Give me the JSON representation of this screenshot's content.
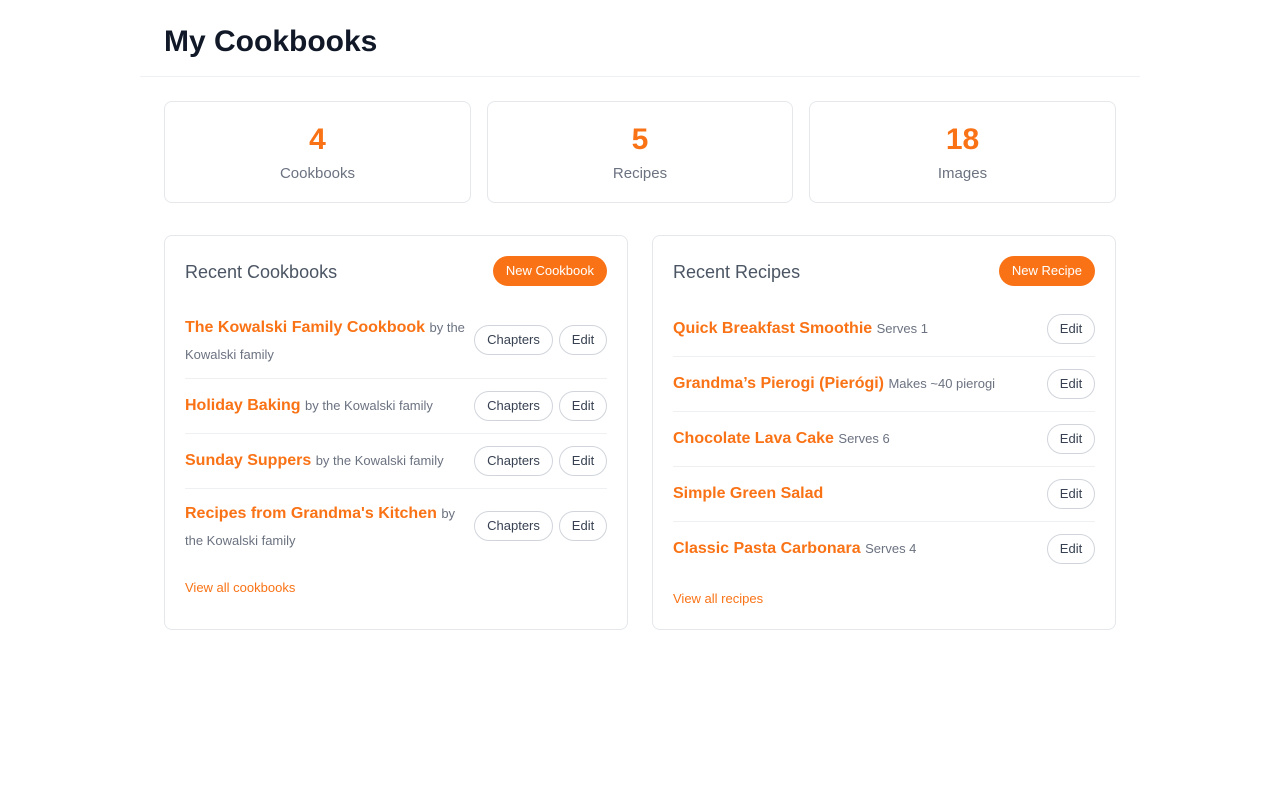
{
  "page": {
    "title": "My Cookbooks"
  },
  "stats": [
    {
      "value": "4",
      "label": "Cookbooks"
    },
    {
      "value": "5",
      "label": "Recipes"
    },
    {
      "value": "18",
      "label": "Images"
    }
  ],
  "recent_cookbooks": {
    "title": "Recent Cookbooks",
    "new_button": "New Cookbook",
    "items": [
      {
        "title": "The Kowalski Family Cookbook",
        "meta": "by the Kowalski family"
      },
      {
        "title": "Holiday Baking",
        "meta": "by the Kowalski family"
      },
      {
        "title": "Sunday Suppers",
        "meta": "by the Kowalski family"
      },
      {
        "title": "Recipes from Grandma's Kitchen",
        "meta": "by the Kowalski family"
      }
    ],
    "chapters_label": "Chapters",
    "edit_label": "Edit",
    "view_all": "View all cookbooks"
  },
  "recent_recipes": {
    "title": "Recent Recipes",
    "new_button": "New Recipe",
    "items": [
      {
        "title": "Quick Breakfast Smoothie",
        "meta": "Serves 1"
      },
      {
        "title": "Grandma’s Pierogi (Pierógi)",
        "meta": "Makes ~40 pierogi"
      },
      {
        "title": "Chocolate Lava Cake",
        "meta": "Serves 6"
      },
      {
        "title": "Simple Green Salad",
        "meta": ""
      },
      {
        "title": "Classic Pasta Carbonara",
        "meta": "Serves 4"
      }
    ],
    "edit_label": "Edit",
    "view_all": "View all recipes"
  },
  "colors": {
    "accent": "#f97316",
    "muted": "#6b7280",
    "border": "#e5e7eb"
  }
}
